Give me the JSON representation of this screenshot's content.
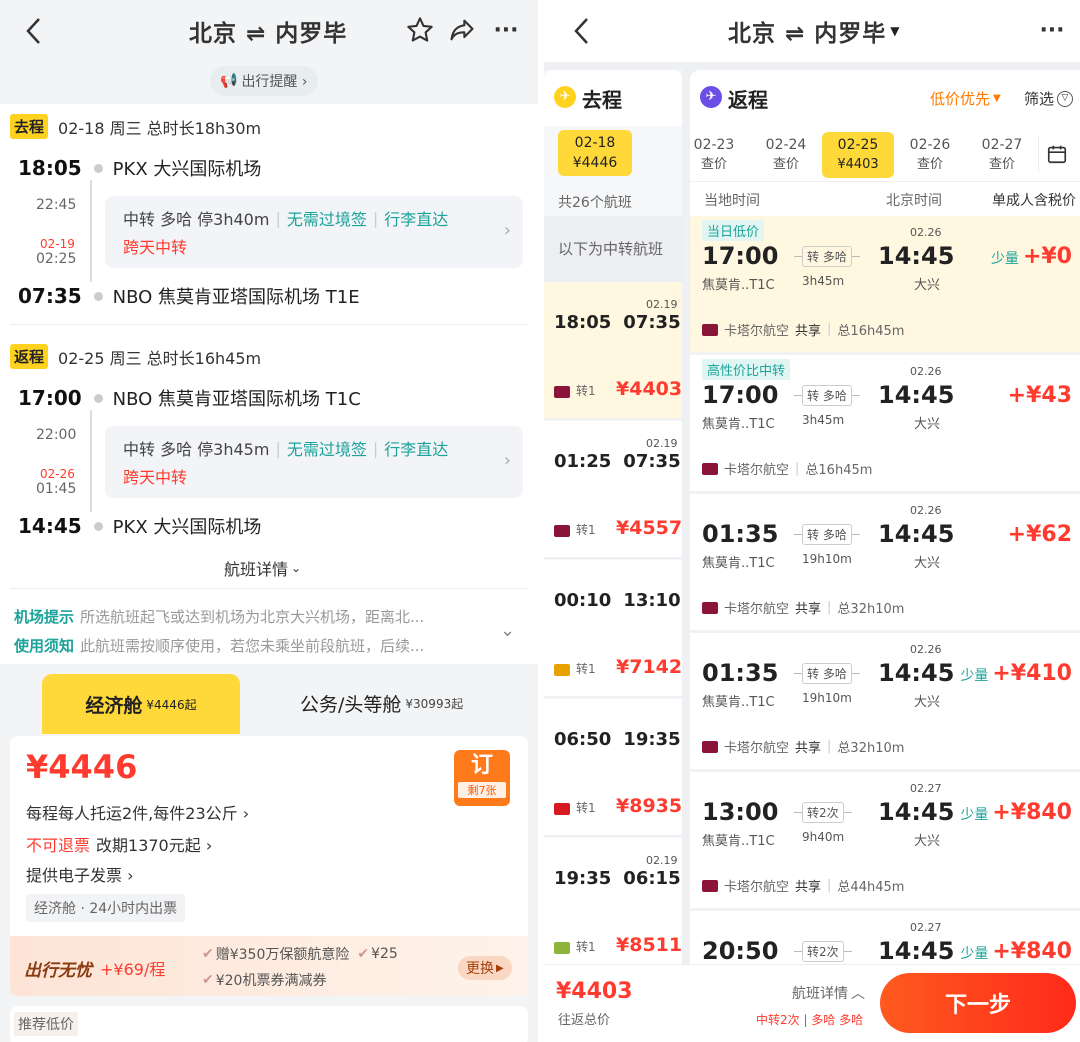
{
  "left": {
    "header": {
      "title": "北京 ⇌ 内罗毕"
    },
    "reminder": "出行提醒 ›",
    "outbound": {
      "tag": "去程",
      "date_info": "02-18 周三 总时长18h30m",
      "dep_time": "18:05",
      "dep_airport": "PKX 大兴国际机场",
      "mid_time": "22:45",
      "next_day": "02-19",
      "arr_mid_time": "02:25",
      "transit": "中转 多哈 停3h40m",
      "no_visa": "无需过境签",
      "baggage": "行李直达",
      "cross_day": "跨天中转",
      "arr_time": "07:35",
      "arr_airport": "NBO 焦莫肯亚塔国际机场 T1E"
    },
    "inbound": {
      "tag": "返程",
      "date_info": "02-25 周三 总时长16h45m",
      "dep_time": "17:00",
      "dep_airport": "NBO 焦莫肯亚塔国际机场 T1C",
      "mid_time": "22:00",
      "next_day": "02-26",
      "arr_mid_time": "01:45",
      "transit": "中转 多哈 停3h45m",
      "no_visa": "无需过境签",
      "baggage": "行李直达",
      "cross_day": "跨天中转",
      "arr_time": "14:45",
      "arr_airport": "PKX 大兴国际机场"
    },
    "detail_link": "航班详情",
    "notice": {
      "airport_label": "机场提示",
      "airport_text": "所选航班起飞或达到机场为北京大兴机场，距离北...",
      "usage_label": "使用须知",
      "usage_text": "此航班需按顺序使用，若您未乘坐前段航班，后续..."
    },
    "cabins": {
      "economy": "经济舱",
      "economy_price": "¥4446起",
      "business": "公务/头等舱",
      "business_price": "¥30993起"
    },
    "fare": {
      "price": "¥4446",
      "baggage": "每程每人托运2件,每件23公斤 ›",
      "refund": "不可退票",
      "change": "改期1370元起 ›",
      "invoice": "提供电子发票 ›",
      "ticketing": "经济舱 · 24小时内出票",
      "book": "订",
      "remaining": "剩7张"
    },
    "insurance": {
      "title": "出行无忧",
      "price": "+¥69/程",
      "item1": "赠¥350万保额航意险",
      "item2": "¥25",
      "item3": "¥20机票券满减券",
      "change": "更换"
    },
    "recommend": "推荐低价"
  },
  "right": {
    "header": {
      "title": "北京 ⇌ 内罗毕"
    },
    "out_tab": "去程",
    "ret_tab": "返程",
    "sort": "低价优先",
    "filter": "筛选",
    "out_date": "02-18",
    "out_price": "¥4446",
    "count": "共26个航班",
    "transfer_note": "以下为中转航班",
    "dates": [
      {
        "d": "02-23",
        "p": "查价"
      },
      {
        "d": "02-24",
        "p": "查价"
      },
      {
        "d": "02-25",
        "p": "¥4403"
      },
      {
        "d": "02-26",
        "p": "查价"
      },
      {
        "d": "02-27",
        "p": "查价"
      }
    ],
    "cols": {
      "local": "当地时间",
      "beijing": "北京时间",
      "price": "单成人含税价"
    },
    "out_flights": [
      {
        "dep": "18:05",
        "arr": "07:35",
        "nd": "02.19",
        "stops": "转1",
        "price": "¥4403"
      },
      {
        "dep": "01:25",
        "arr": "07:35",
        "nd": "02.19",
        "stops": "转1",
        "price": "¥4557"
      },
      {
        "dep": "00:10",
        "arr": "13:10",
        "nd": "",
        "stops": "转1",
        "price": "¥7142"
      },
      {
        "dep": "06:50",
        "arr": "19:35",
        "nd": "",
        "stops": "转1",
        "price": "¥8935"
      },
      {
        "dep": "19:35",
        "arr": "06:15",
        "nd": "02.19",
        "stops": "转1",
        "price": "¥8511"
      }
    ],
    "ret_flights": [
      {
        "badge": "当日低价",
        "dep": "17:00",
        "from": "焦莫肯..T1C",
        "via": "转 多哈",
        "dur": "3h45m",
        "arr": "14:45",
        "nd": "02.26",
        "to": "大兴",
        "airline": "卡塔尔航空",
        "share": "共享",
        "total": "总16h45m",
        "few": "少量",
        "price": "+¥0"
      },
      {
        "badge": "高性价比中转",
        "dep": "17:00",
        "from": "焦莫肯..T1C",
        "via": "转 多哈",
        "dur": "3h45m",
        "arr": "14:45",
        "nd": "02.26",
        "to": "大兴",
        "airline": "卡塔尔航空",
        "share": "",
        "total": "总16h45m",
        "few": "",
        "price": "+¥43"
      },
      {
        "badge": "",
        "dep": "01:35",
        "from": "焦莫肯..T1C",
        "via": "转 多哈",
        "dur": "19h10m",
        "arr": "14:45",
        "nd": "02.26",
        "to": "大兴",
        "airline": "卡塔尔航空",
        "share": "共享",
        "total": "总32h10m",
        "few": "",
        "price": "+¥62"
      },
      {
        "badge": "",
        "dep": "01:35",
        "from": "焦莫肯..T1C",
        "via": "转 多哈",
        "dur": "19h10m",
        "arr": "14:45",
        "nd": "02.26",
        "to": "大兴",
        "airline": "卡塔尔航空",
        "share": "共享",
        "total": "总32h10m",
        "few": "少量",
        "price": "+¥410"
      },
      {
        "badge": "",
        "dep": "13:00",
        "from": "焦莫肯..T1C",
        "via": "转2次",
        "dur": "9h40m",
        "arr": "14:45",
        "nd": "02.27",
        "to": "大兴",
        "airline": "卡塔尔航空",
        "share": "共享",
        "total": "总44h45m",
        "few": "少量",
        "price": "+¥840"
      },
      {
        "badge": "",
        "dep": "20:50",
        "from": "",
        "via": "转2次",
        "dur": "",
        "arr": "14:45",
        "nd": "02.27",
        "to": "",
        "airline": "",
        "share": "",
        "total": "",
        "few": "少量",
        "price": "+¥840"
      }
    ],
    "footer": {
      "total": "¥4403",
      "total_label": "往返总价",
      "details": "航班详情",
      "summary": "中转2次 | 多哈 多哈",
      "next": "下一步"
    }
  },
  "colors": {
    "accent": "#ff3b2f",
    "yellow": "#ffd21f",
    "teal": "#1aa39a",
    "purple": "#6b4ee6"
  }
}
